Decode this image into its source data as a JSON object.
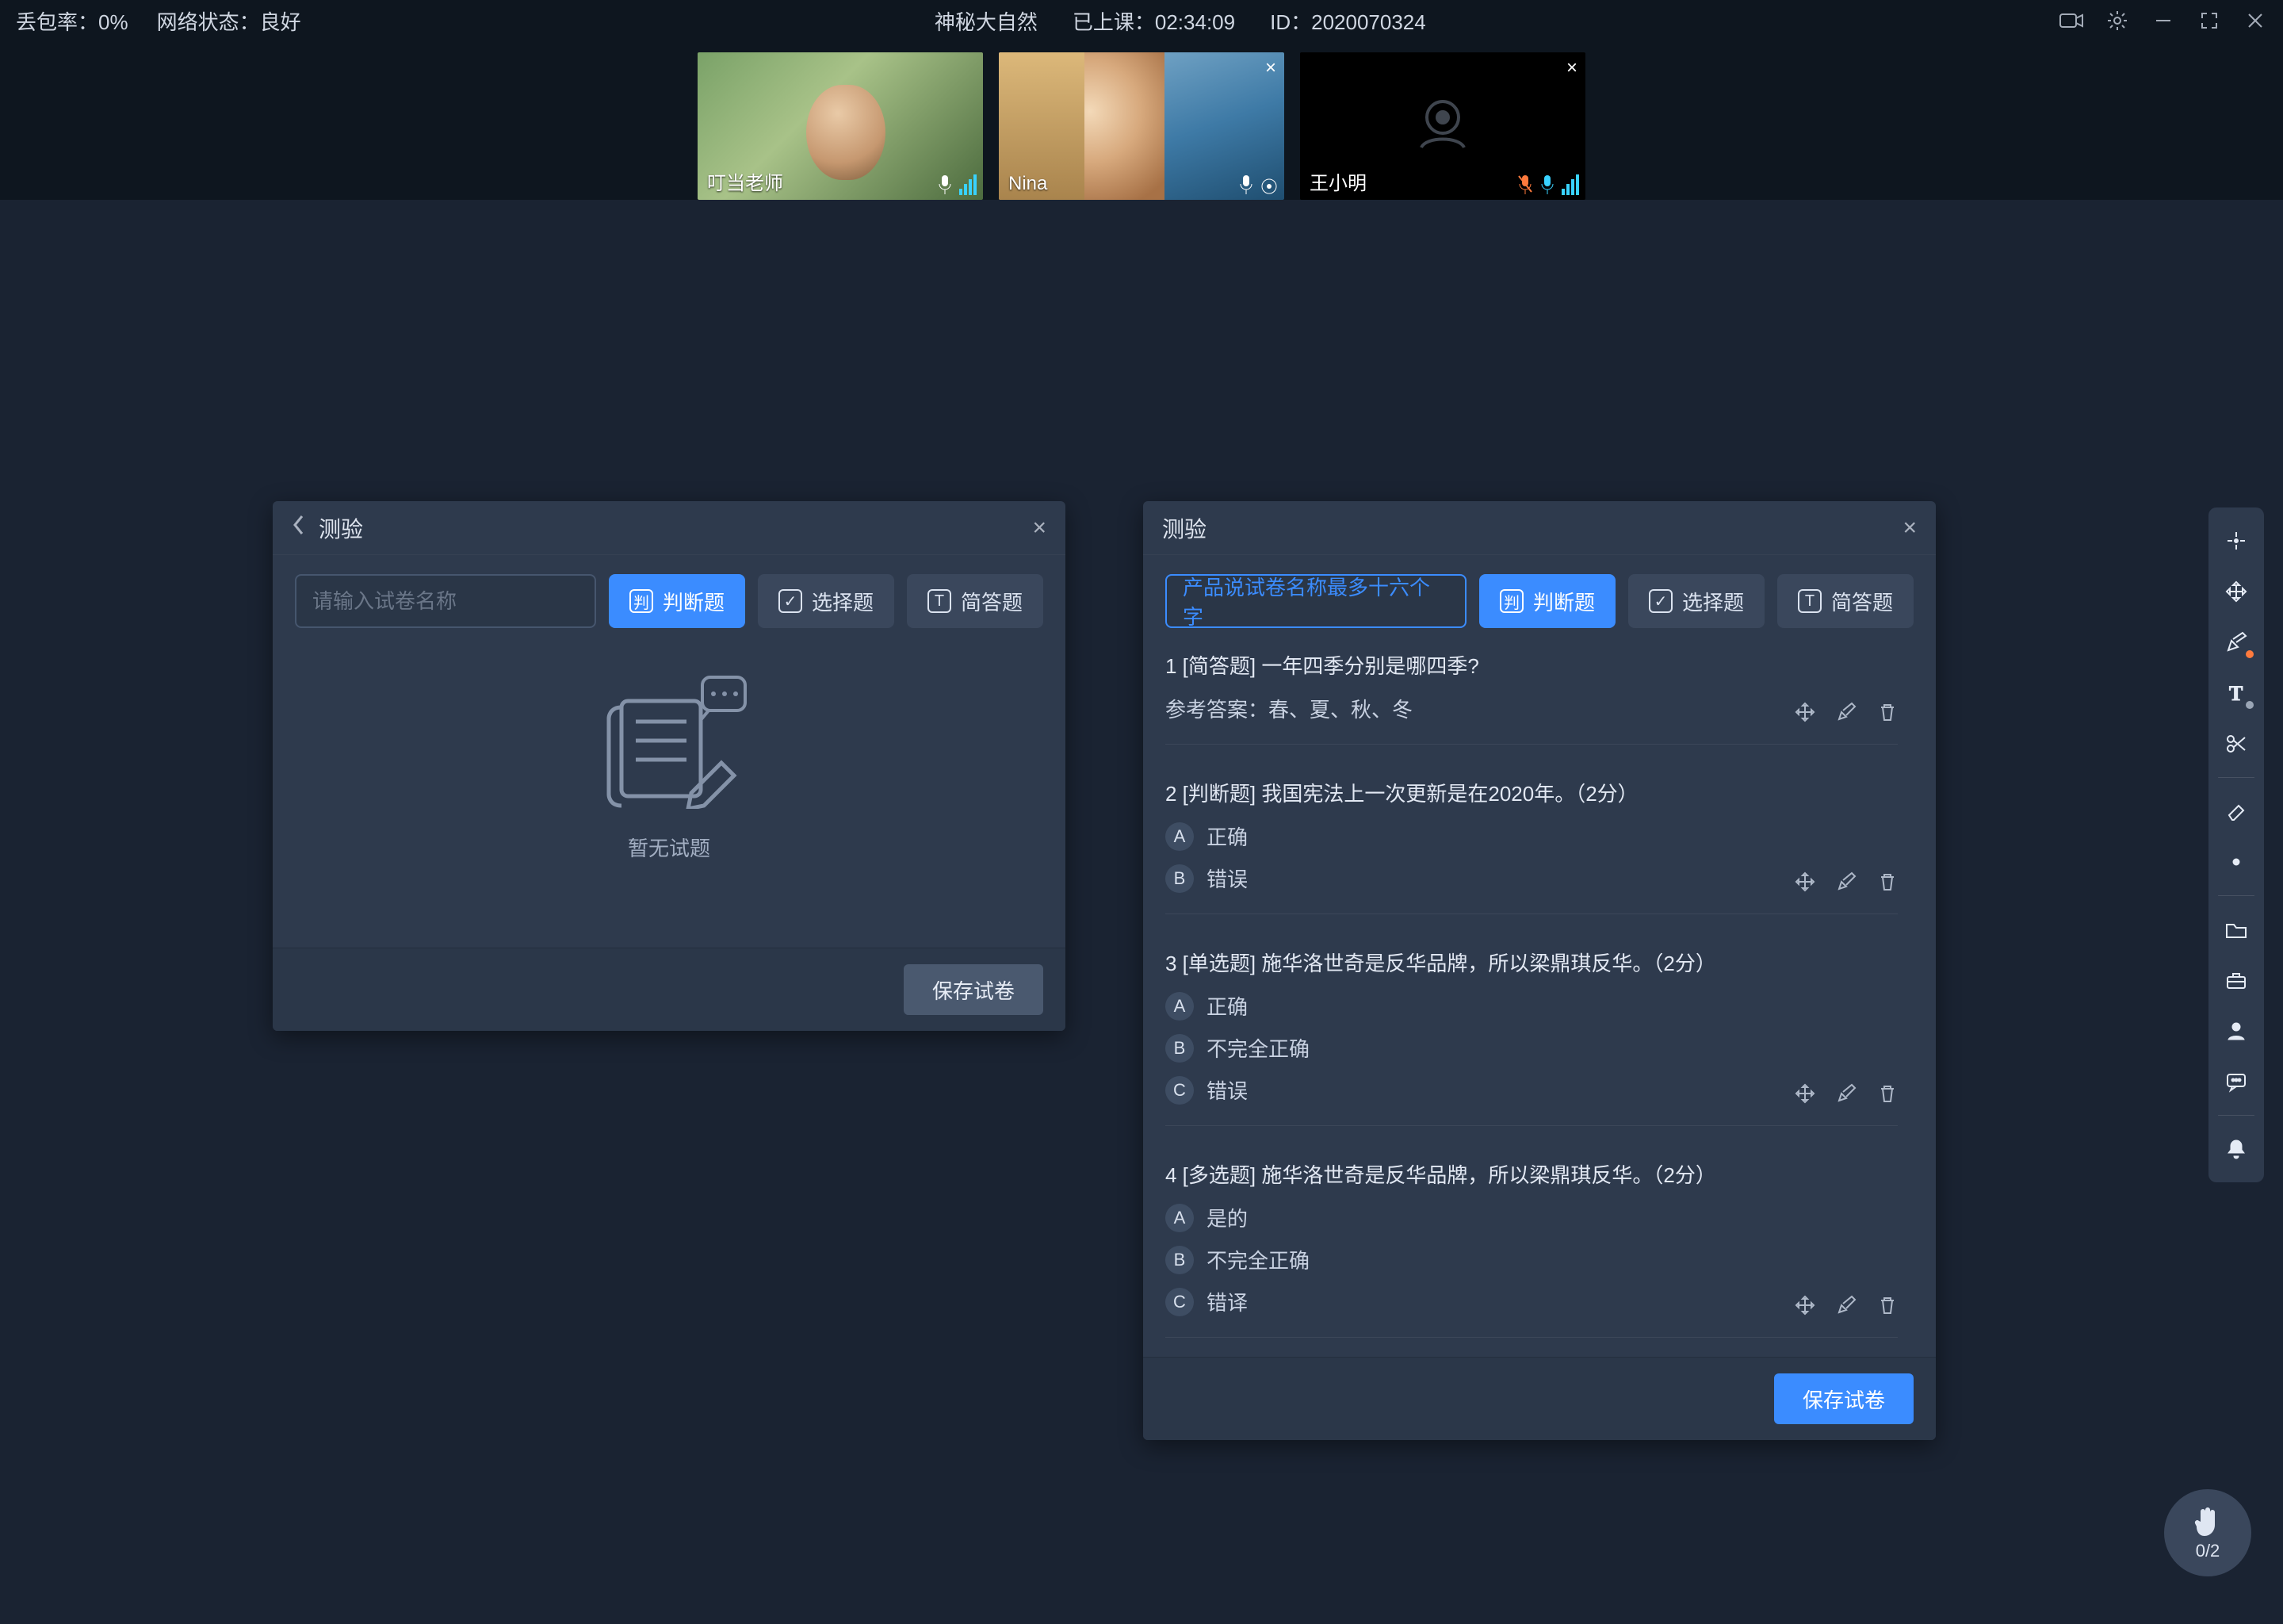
{
  "topbar": {
    "packet_loss_label": "丢包率：0%",
    "net_status_label": "网络状态：良好",
    "course_title": "神秘大自然",
    "elapsed_label": "已上课：02:34:09",
    "session_id_label": "ID：2020070324"
  },
  "participants": [
    {
      "name": "叮当老师",
      "camera": "on",
      "has_close": false,
      "mic_muted": false
    },
    {
      "name": "Nina",
      "camera": "on",
      "has_close": true,
      "mic_muted": false
    },
    {
      "name": "王小明",
      "camera": "off",
      "has_close": true,
      "mic_muted": true
    }
  ],
  "panel_quiz_empty": {
    "title": "测验",
    "input_placeholder": "请输入试卷名称",
    "chip_judge": "判断题",
    "chip_choice": "选择题",
    "chip_short": "简答题",
    "empty_text": "暂无试题",
    "save_btn": "保存试卷"
  },
  "panel_quiz_full": {
    "title": "测验",
    "input_value": "产品说试卷名称最多十六个字",
    "chip_judge": "判断题",
    "chip_choice": "选择题",
    "chip_short": "简答题",
    "save_btn": "保存试卷",
    "answer_prefix": "参考答案：",
    "questions": [
      {
        "num": "1",
        "tag": "[简答题]",
        "text": "一年四季分别是哪四季?",
        "answer": "春、夏、秋、冬",
        "options": []
      },
      {
        "num": "2",
        "tag": "[判断题]",
        "text": "我国宪法上一次更新是在2020年。（2分）",
        "options": [
          {
            "bullet": "A",
            "label": "正确"
          },
          {
            "bullet": "B",
            "label": "错误"
          }
        ]
      },
      {
        "num": "3",
        "tag": "[单选题]",
        "text": "施华洛世奇是反华品牌，所以梁鼎琪反华。（2分）",
        "options": [
          {
            "bullet": "A",
            "label": "正确"
          },
          {
            "bullet": "B",
            "label": "不完全正确"
          },
          {
            "bullet": "C",
            "label": "错误"
          }
        ]
      },
      {
        "num": "4",
        "tag": "[多选题]",
        "text": "施华洛世奇是反华品牌，所以梁鼎琪反华。（2分）",
        "options": [
          {
            "bullet": "A",
            "label": "是的"
          },
          {
            "bullet": "B",
            "label": "不完全正确"
          },
          {
            "bullet": "C",
            "label": "错译"
          }
        ]
      }
    ]
  },
  "hand_badge": {
    "count": "0/2"
  }
}
